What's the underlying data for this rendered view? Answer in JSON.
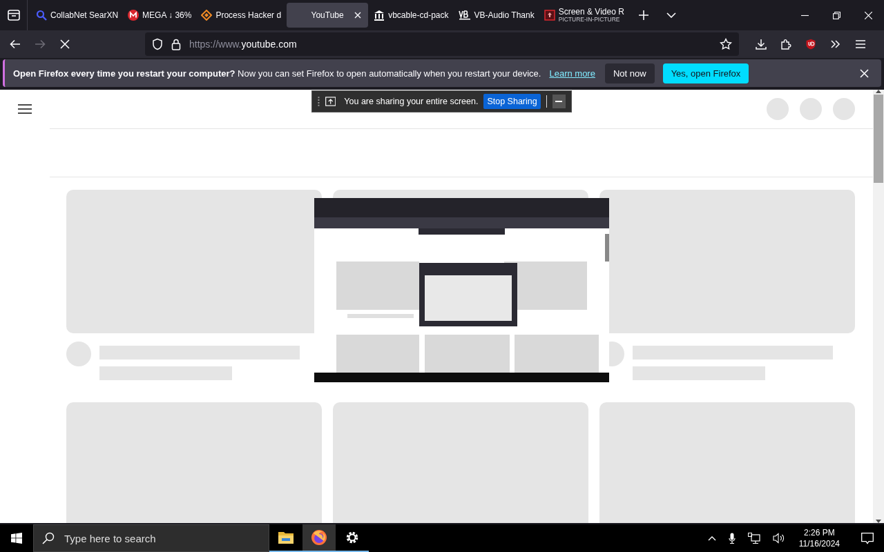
{
  "tabs": [
    {
      "label": "CollabNet SearXN",
      "kind": "search",
      "selected": false
    },
    {
      "label": "MEGA ↓ 36%",
      "kind": "mega",
      "selected": false
    },
    {
      "label": "Process Hacker d",
      "kind": "diamond",
      "selected": false
    },
    {
      "label": "YouTube",
      "kind": "none",
      "selected": true
    },
    {
      "label": "vbcable-cd-pack",
      "kind": "bank",
      "selected": false
    },
    {
      "label": "VB-Audio Thank",
      "kind": "vb",
      "selected": false
    },
    {
      "label": "Screen & Video R",
      "subtitle": "PICTURE-IN-PICTURE",
      "kind": "record",
      "selected": false
    }
  ],
  "address_bar": {
    "url_prefix": "https://www.",
    "url_domain": "youtube.com"
  },
  "notification": {
    "message": "**Open Firefox every time you restart your computer?** Now you can set Firefox to open automatically when you restart your device.",
    "link": "Learn more",
    "buttons": [
      {
        "label": "Not now",
        "kind": "secondary"
      },
      {
        "label": "Yes, open Firefox",
        "kind": "primary"
      }
    ]
  },
  "sharing_bar": {
    "message": "You are sharing your entire screen.",
    "button": "Stop Sharing"
  },
  "taskbar": {
    "search_placeholder": "Type here to search",
    "apps": [
      {
        "kind": "folder",
        "selected": false
      },
      {
        "kind": "firefox",
        "selected": true
      },
      {
        "kind": "gear",
        "selected": false
      }
    ],
    "time": "2:26 PM",
    "date": "11/16/2024"
  }
}
